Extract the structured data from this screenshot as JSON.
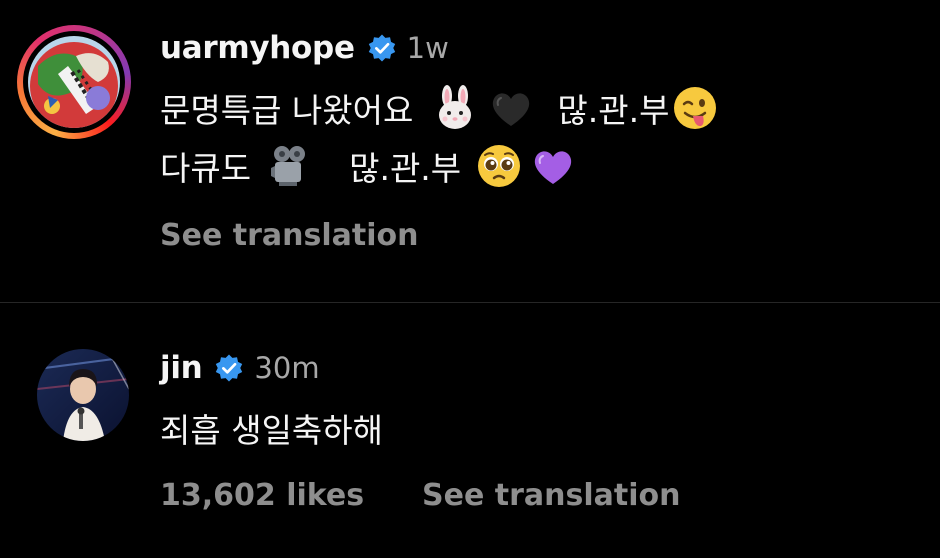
{
  "colors": {
    "background": "#000000",
    "text_primary": "#f5f5f5",
    "text_secondary": "#8e8e8e",
    "verified_blue": "#3897f0",
    "divider": "#262626"
  },
  "comments": [
    {
      "username": "uarmyhope",
      "verified": true,
      "verified_icon": "verified-badge-icon",
      "time": "1w",
      "has_story_ring": true,
      "line1": {
        "text_a": "문명특급 나왔어요",
        "emoji_a": "rabbit-face-emoji",
        "emoji_b": "black-heart-emoji",
        "text_b": "많.관.부",
        "emoji_c": "winking-face-with-tongue-emoji"
      },
      "line2": {
        "text_a": "다큐도",
        "emoji_a": "film-projector-emoji",
        "text_b": "많.관.부",
        "emoji_b": "pleading-face-emoji",
        "emoji_c": "purple-heart-emoji"
      },
      "see_translation": "See translation"
    },
    {
      "username": "jin",
      "verified": true,
      "verified_icon": "verified-badge-icon",
      "time": "30m",
      "has_story_ring": false,
      "text": "죄흡 생일축하해",
      "likes": "13,602 likes",
      "see_translation": "See translation"
    }
  ]
}
